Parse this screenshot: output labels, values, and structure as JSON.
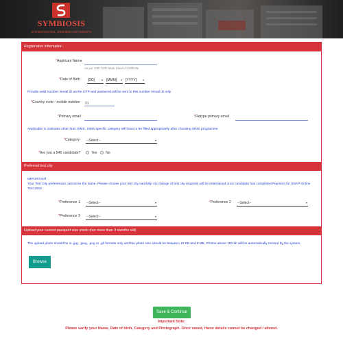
{
  "header": {
    "logo_name": "SYMBIOSIS",
    "logo_subtitle": "INTERNATIONAL (DEEMED UNIVERSITY)"
  },
  "colors": {
    "accent_red": "#d6323a",
    "button_teal": "#129c8e",
    "button_green": "#3eb55a",
    "info_blue": "#1a3bd1"
  },
  "registration": {
    "title": "Registration information",
    "applicant_name_label": "Applicant Name",
    "applicant_name_hint": "As per 10th /12th Mark Sheet /Certificate",
    "dob_label": "Date of Birth",
    "dob_day": "[DD]",
    "dob_month": "[MMM]",
    "dob_year": "[YYYY]",
    "email_info": "Provide valid number /email ID as the OTP and password will be sent to this number /email ID only",
    "country_code_label": "Country code - mobile number",
    "country_code_value": "91",
    "primary_email_label": "Primary email",
    "retype_email_label": "Retype primary email",
    "category_info": "Applicable to institutes other than SIMS. SIMS specific category will have to be filled appropriately after choosing SIMS programme",
    "category_label": "Category",
    "category_value": "--Select--",
    "nri_label": "Are you a NRI candidate?",
    "nri_yes": "Yes",
    "nri_no": "No"
  },
  "test_city": {
    "title": "Preferred test city",
    "important_label": "IMPORTANT",
    "important_text": "Your Test City preferences cannot be the same. Please choose your test city carefully. No change of test city requests will be entertained once candidate has completed Payment for SNAP Online Test 2019.",
    "pref1_label": "Preference 1",
    "pref2_label": "Preference 2",
    "pref3_label": "Preference 3",
    "select_value": "--Select--"
  },
  "photo": {
    "title": "Upload your current passport size photo (not more than 3 months old)",
    "info": "The upload photo should be in .jpg, .jpeg, .png or .gif formats only and the photo size should be between 10 KB and 5 MB. Photos above 100 kb will be automatically resized by the system.",
    "browse_label": "Browse"
  },
  "footer": {
    "save_label": "Save & Continue",
    "note_title": "Important Note:",
    "note_body": "Please verify your Name, Date of birth, Category and Photograph. Once saved, these details cannot be changed / altered."
  }
}
